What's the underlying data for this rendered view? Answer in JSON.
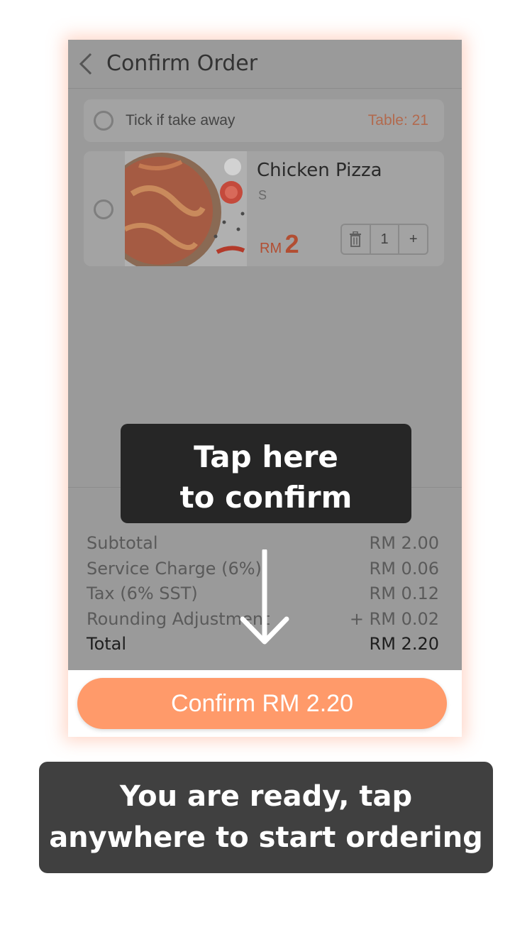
{
  "header": {
    "title": "Confirm Order"
  },
  "takeaway": {
    "label": "Tick if take away",
    "table": "Table: 21"
  },
  "item": {
    "name": "Chicken Pizza",
    "size": "S",
    "currency": "RM",
    "price": "2",
    "quantity": "1",
    "plus": "+"
  },
  "summary": {
    "rows": [
      {
        "label": "Subtotal",
        "value": "RM 2.00"
      },
      {
        "label": "Service Charge (6%)",
        "value": "RM 0.06"
      },
      {
        "label": "Tax (6% SST)",
        "value": "RM 0.12"
      },
      {
        "label": "Rounding Adjustment",
        "value": "+ RM 0.02"
      },
      {
        "label": "Total",
        "value": "RM 2.20"
      }
    ]
  },
  "confirm": {
    "label": "Confirm RM 2.20"
  },
  "overlay": {
    "hint_line1": "Tap here",
    "hint_line2": "to confirm",
    "ready_line1": "You are ready, tap",
    "ready_line2": "anywhere to start ordering"
  },
  "colors": {
    "accent": "#ff9a6a",
    "price": "#b24e32",
    "table": "#b26a4e",
    "dim_overlay": "#9a9a9a"
  },
  "icons": {
    "back": "chevron-left-icon",
    "radio": "radio-unchecked-icon",
    "trash": "trash-icon",
    "plus": "plus-icon",
    "expand": "chevron-down-icon",
    "arrow": "arrow-down-icon"
  }
}
